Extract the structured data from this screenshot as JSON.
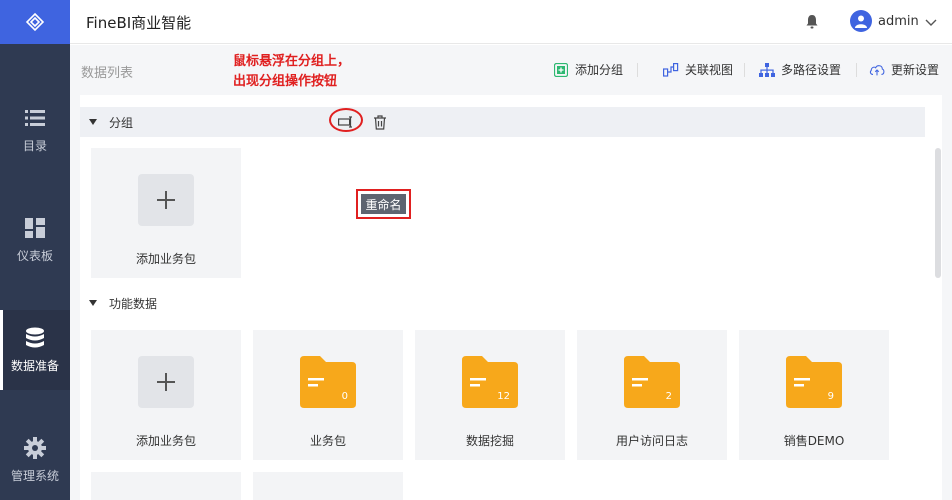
{
  "header": {
    "app_title": "FineBI商业智能",
    "username": "admin"
  },
  "sidebar": {
    "items": [
      {
        "label": "目录",
        "icon": "list-icon"
      },
      {
        "label": "仪表板",
        "icon": "dashboard-icon"
      },
      {
        "label": "数据准备",
        "icon": "database-icon",
        "active": true
      },
      {
        "label": "管理系统",
        "icon": "gear-icon"
      }
    ]
  },
  "main": {
    "list_title": "数据列表",
    "annotation": "鼠标悬浮在分组上，\n出现分组操作按钮",
    "toolbar": {
      "add_group": "添加分组",
      "relation_view": "关联视图",
      "multipath": "多路径设置",
      "update_settings": "更新设置"
    }
  },
  "groups": [
    {
      "name": "分组",
      "tooltip": "重命名",
      "cards": [
        {
          "label": "添加业务包",
          "type": "add"
        }
      ]
    },
    {
      "name": "功能数据",
      "cards": [
        {
          "label": "添加业务包",
          "type": "add"
        },
        {
          "label": "业务包",
          "type": "folder",
          "count": "0"
        },
        {
          "label": "数据挖掘",
          "type": "folder",
          "count": "12"
        },
        {
          "label": "用户访问日志",
          "type": "folder",
          "count": "2"
        },
        {
          "label": "销售DEMO",
          "type": "folder",
          "count": "9"
        }
      ]
    }
  ],
  "colors": {
    "sidebar_bg": "#2f3a52",
    "logo_bg": "#3f64e0",
    "folder": "#f7a81b",
    "annotation": "#e02020",
    "add_group_green": "#2eb872",
    "accent_blue": "#3f64e0"
  }
}
